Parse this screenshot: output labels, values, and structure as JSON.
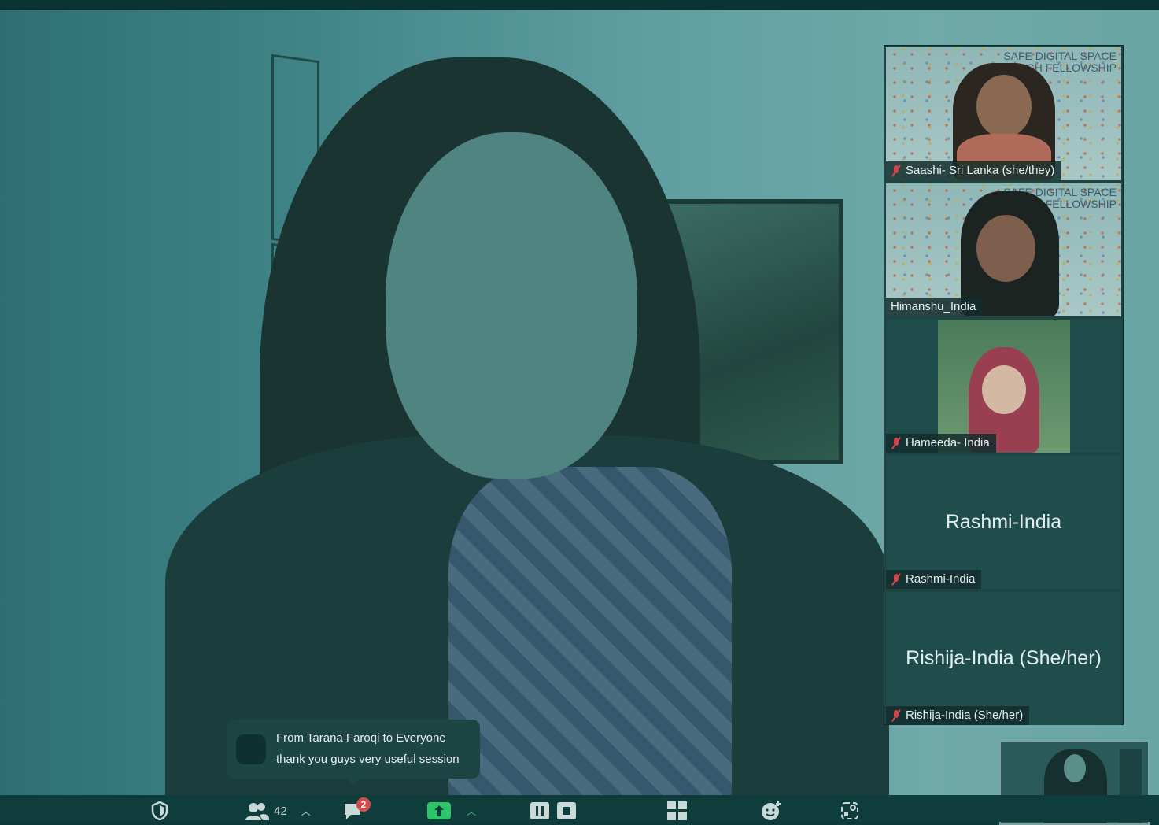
{
  "speaker": {
    "description_color": "#5f9ea0"
  },
  "participants": [
    {
      "name": "Saashi- Sri Lanka  (she/they)",
      "muted": true,
      "type": "video-banner"
    },
    {
      "name": "Himanshu_India",
      "muted": false,
      "type": "video-banner"
    },
    {
      "name": "Hameeda- India",
      "muted": true,
      "type": "video"
    },
    {
      "name": "Rashmi-India",
      "muted": true,
      "type": "no-video",
      "display_name": "Rashmi-India"
    },
    {
      "name": "Rishija-India (She/her)",
      "muted": true,
      "type": "no-video",
      "display_name": "Rishija-India (She/her)"
    }
  ],
  "banner": {
    "line1": "SAFE DIGITAL SPACE",
    "line2": "SEARCH FELLOWSHIP"
  },
  "chat_toast": {
    "header": "From Tarana Faroqi to Everyone",
    "message": "thank you guys very useful session"
  },
  "toolbar": {
    "participant_count": "42",
    "chat_badge": "2",
    "icons": [
      "security-shield-icon",
      "participants-icon",
      "chat-icon",
      "share-screen-icon",
      "pause-icon",
      "stop-icon",
      "apps-grid-icon",
      "reactions-icon",
      "whiteboard-icon"
    ]
  },
  "colors": {
    "accent_green": "#2ec46a",
    "badge_red": "#d54a4a",
    "muted_red": "#d04545"
  }
}
